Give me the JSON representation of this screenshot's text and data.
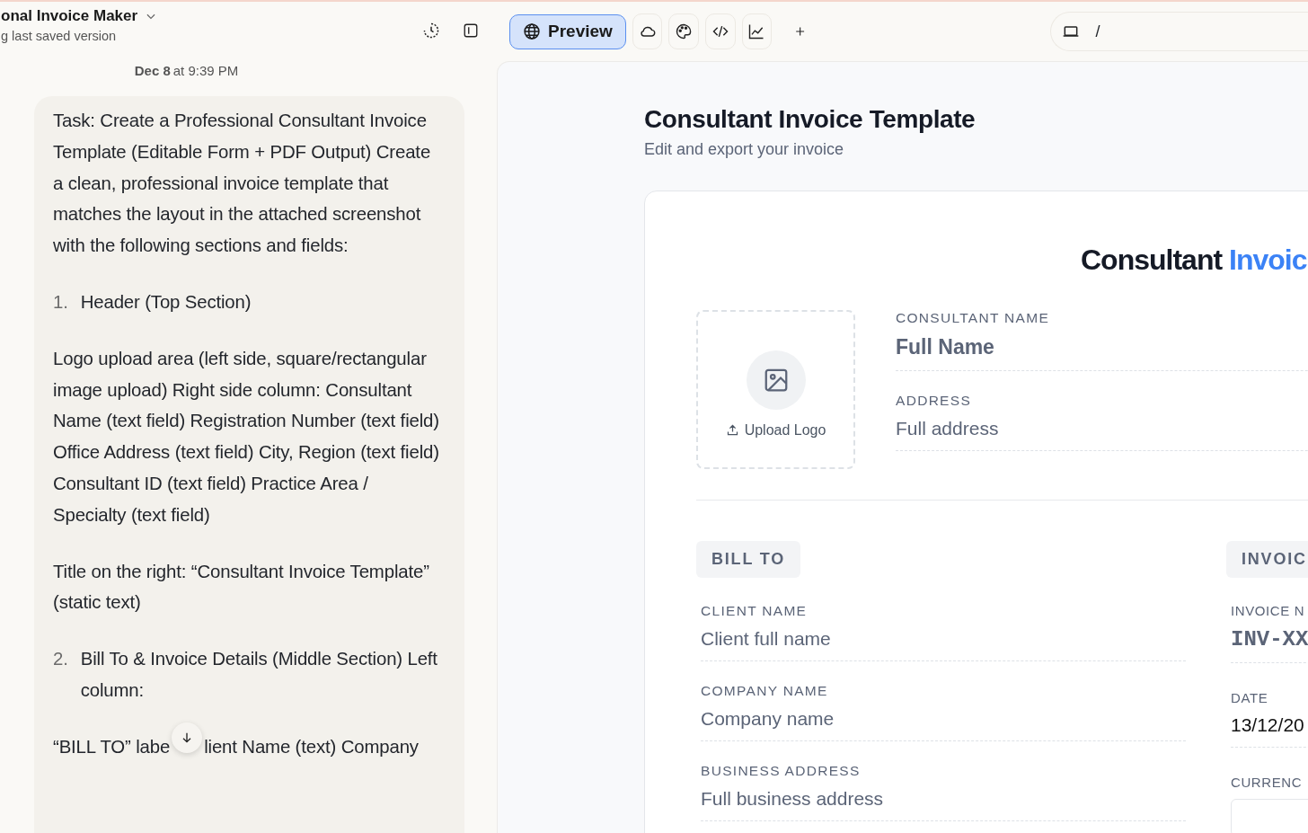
{
  "header": {
    "title": "onal Invoice Maker",
    "subtitle": "g last saved version"
  },
  "toolbar": {
    "tabs": [
      {
        "kind": "preview",
        "label": "Preview",
        "selected": true
      },
      {
        "kind": "cloud",
        "selected": false
      },
      {
        "kind": "palette",
        "selected": false
      },
      {
        "kind": "code",
        "selected": false
      },
      {
        "kind": "chart",
        "selected": false
      }
    ],
    "address": "/"
  },
  "chat": {
    "date": "Dec 8",
    "time": "at 9:39 PM",
    "paragraphs": [
      {
        "kind": "text",
        "text": "Task: Create a Professional Consultant Invoice Template (Editable Form + PDF Output) Create a clean, professional invoice template that matches the layout in the attached screenshot with the following sections and fields:"
      },
      {
        "kind": "numbered",
        "number": "1.",
        "text": "Header (Top Section)"
      },
      {
        "kind": "text",
        "text": "Logo upload area (left side, square/rectangular image upload) Right side column: Consultant Name (text field) Registration Number (text field) Office Address (text field) City, Region (text field) Consultant ID (text field) Practice Area / Specialty (text field)"
      },
      {
        "kind": "text",
        "text": "Title on the right: “Consultant Invoice Template” (static text)"
      },
      {
        "kind": "numbered",
        "number": "2.",
        "text": "Bill To & Invoice Details (Middle Section) Left column:"
      },
      {
        "kind": "split",
        "before": "“BILL TO” labe",
        "after": "lient Name (text) Company"
      }
    ]
  },
  "preview": {
    "title": "Consultant Invoice Template",
    "subtitle": "Edit and export your invoice",
    "document": {
      "heading": {
        "dark": "Consultant",
        "accent": "Invoic"
      },
      "logo_upload": "Upload Logo",
      "consultant_fields": [
        {
          "label": "CONSULTANT NAME",
          "placeholder": "Full Name",
          "kind": "large"
        },
        {
          "label": "ADDRESS",
          "placeholder": "Full address",
          "kind": "plain"
        }
      ],
      "bill_to": {
        "badge": "BILL TO",
        "fields": [
          {
            "label": "CLIENT NAME",
            "placeholder": "Client full name"
          },
          {
            "label": "COMPANY NAME",
            "placeholder": "Company name"
          },
          {
            "label": "BUSINESS ADDRESS",
            "placeholder": "Full business address"
          }
        ]
      },
      "invoice": {
        "badge": "INVOIC",
        "fields": [
          {
            "label": "INVOICE N",
            "value": "INV-XX",
            "kind": "mono"
          },
          {
            "label": "DATE",
            "value": "13/12/20",
            "kind": "plain"
          },
          {
            "label": "CURRENC",
            "kind": "select"
          }
        ]
      }
    }
  }
}
